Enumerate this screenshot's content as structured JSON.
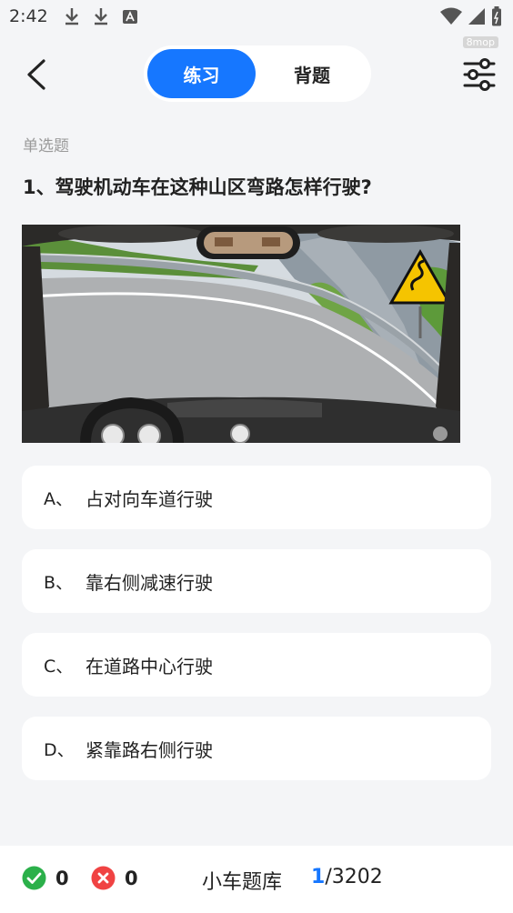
{
  "status": {
    "time": "2:42",
    "watermark": "8mop"
  },
  "header": {
    "tabs": [
      {
        "label": "练习",
        "active": true
      },
      {
        "label": "背题",
        "active": false
      }
    ]
  },
  "question": {
    "type": "单选题",
    "text": "1、驾驶机动车在这种山区弯路怎样行驶?"
  },
  "options": [
    {
      "letter": "A、",
      "text": "占对向车道行驶"
    },
    {
      "letter": "B、",
      "text": "靠右侧减速行驶"
    },
    {
      "letter": "C、",
      "text": "在道路中心行驶"
    },
    {
      "letter": "D、",
      "text": "紧靠路右侧行驶"
    }
  ],
  "footer": {
    "correct_count": "0",
    "wrong_count": "0",
    "bank_label": "小车题库",
    "current": "1",
    "total": "/3202"
  },
  "colors": {
    "accent": "#1677ff",
    "correct": "#2bb04a",
    "wrong": "#f04343"
  }
}
